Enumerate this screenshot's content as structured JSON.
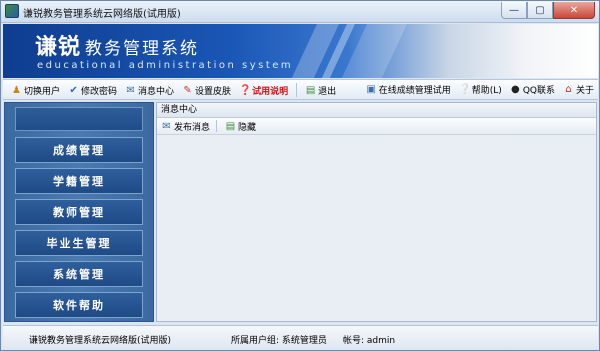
{
  "window": {
    "title": "谦锐教务管理系统云网络版(试用版)",
    "controls": {
      "minimize": "—",
      "maximize": "▢",
      "close": "✕"
    }
  },
  "banner": {
    "brand_main": "谦锐",
    "brand_sub": "教务管理系统",
    "tagline": "educational administration system"
  },
  "toolbar": {
    "left": [
      {
        "label": "切换用户",
        "icon": "user-switch-icon"
      },
      {
        "label": "修改密码",
        "icon": "checkmark-icon"
      },
      {
        "label": "消息中心",
        "icon": "message-icon"
      },
      {
        "label": "设置皮肤",
        "icon": "brush-icon"
      },
      {
        "label": "试用说明",
        "icon": "help-doc-icon",
        "highlight": "#d01818"
      },
      {
        "label": "退出",
        "icon": "exit-icon"
      }
    ],
    "right": [
      {
        "label": "在线成绩管理试用",
        "icon": "network-icon"
      },
      {
        "label": "帮助(L)",
        "icon": "help-icon"
      },
      {
        "label": "QQ联系",
        "icon": "qq-icon"
      },
      {
        "label": "关于",
        "icon": "home-icon"
      }
    ]
  },
  "menu": {
    "items": [
      "成绩管理",
      "学籍管理",
      "教师管理",
      "毕业生管理",
      "系统管理",
      "软件帮助"
    ]
  },
  "content": {
    "header": "消息中心",
    "actions": [
      {
        "label": "发布消息",
        "icon": "publish-icon"
      },
      {
        "label": "隐藏",
        "icon": "hide-icon"
      }
    ]
  },
  "status": {
    "app": "谦锐教务管理系统云网络版(试用版)",
    "group": "所属用户组: 系统管理员",
    "account": "帐号: admin"
  },
  "colors": {
    "accent": "#1e4a85",
    "highlight": "#d01818"
  }
}
